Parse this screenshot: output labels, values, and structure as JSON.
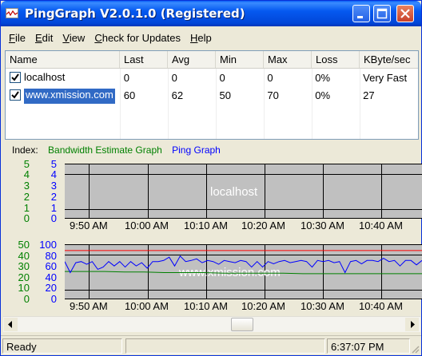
{
  "window": {
    "title": "PingGraph V2.0.1.0 (Registered)"
  },
  "menu": [
    {
      "label": "File",
      "key": "F",
      "rest": "ile"
    },
    {
      "label": "Edit",
      "key": "E",
      "rest": "dit"
    },
    {
      "label": "View",
      "key": "V",
      "rest": "iew"
    },
    {
      "label": "Check for Updates",
      "key": "C",
      "rest": "heck for Updates"
    },
    {
      "label": "Help",
      "key": "H",
      "rest": "elp"
    }
  ],
  "list": {
    "columns": [
      "Name",
      "Last",
      "Avg",
      "Min",
      "Max",
      "Loss",
      "KByte/sec"
    ],
    "rows": [
      {
        "checked": true,
        "selected": false,
        "name": "localhost",
        "last": "0",
        "avg": "0",
        "min": "0",
        "max": "0",
        "loss": "0%",
        "kbps": "Very Fast"
      },
      {
        "checked": true,
        "selected": true,
        "name": "www.xmission.com",
        "last": "60",
        "avg": "62",
        "min": "50",
        "max": "70",
        "loss": "0%",
        "kbps": "27"
      }
    ]
  },
  "index": {
    "label": "Index:",
    "bandwidth": "Bandwidth Estimate Graph",
    "ping": "Ping Graph"
  },
  "graphs": [
    {
      "watermark": "localhost",
      "bw_ticks": [
        "5",
        "4",
        "3",
        "2",
        "1",
        "0"
      ],
      "ping_ticks": [
        "5",
        "4",
        "3",
        "2",
        "1",
        "0"
      ],
      "time_labels": [
        "9:50 AM",
        "10:00 AM",
        "10:10 AM",
        "10:20 AM",
        "10:30 AM",
        "10:40 AM"
      ]
    },
    {
      "watermark": "www.xmission.com",
      "bw_ticks": [
        "50",
        "40",
        "30",
        "20",
        "10",
        "0"
      ],
      "ping_ticks": [
        "100",
        "80",
        "60",
        "40",
        "20",
        "0"
      ],
      "time_labels": [
        "9:50 AM",
        "10:00 AM",
        "10:10 AM",
        "10:20 AM",
        "10:30 AM",
        "10:40 AM"
      ],
      "max_ping_line": 90,
      "bandwidth_series": [
        26,
        26,
        26,
        25.5,
        25.5,
        25,
        25,
        25,
        24.5,
        24.5,
        24.5,
        24.5,
        24,
        24,
        24,
        24,
        24,
        24,
        24
      ],
      "ping_series": [
        70,
        50,
        68,
        70,
        65,
        70,
        56,
        60,
        70,
        62,
        70,
        60,
        70,
        62,
        68,
        58,
        70,
        70,
        72,
        78,
        62,
        80,
        70,
        72,
        75,
        68,
        72,
        70,
        65,
        72,
        70,
        68,
        72,
        70,
        60,
        70,
        60,
        70,
        66,
        70,
        72,
        68,
        70,
        72,
        70,
        60,
        72,
        70,
        72,
        68,
        70,
        50,
        70,
        72,
        66,
        72,
        72,
        70,
        76,
        70,
        72,
        62,
        72,
        72,
        64,
        72
      ]
    }
  ],
  "status": {
    "text": "Ready",
    "time": "6:37:07 PM"
  },
  "colors": {
    "bandwidth": "#008000",
    "ping": "#0000ff",
    "max_line": "#ff0000",
    "selection": "#316ac5"
  }
}
